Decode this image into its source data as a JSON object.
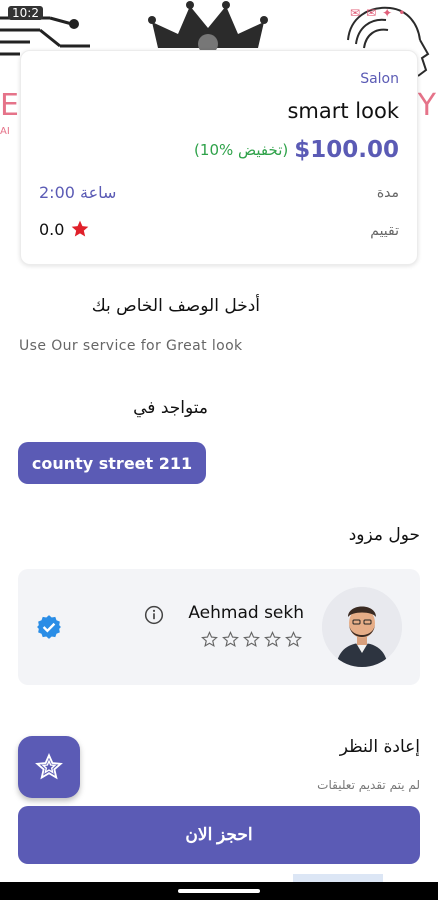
{
  "status_bar": {
    "time": "10:2"
  },
  "hero": {
    "brand_left": "EA",
    "brand_right": "Y",
    "brand_sub": "AI"
  },
  "service": {
    "category": "Salon",
    "title": "smart look",
    "price": "$100.00",
    "discount": "(10% تخفيض)",
    "duration_label": "مدة",
    "duration_value": "2:00 ساعة",
    "rating_label": "تقييم",
    "rating_value": "0.0"
  },
  "description": {
    "heading": "أدخل الوصف الخاص بك",
    "text": "Use Our service for Great look"
  },
  "location": {
    "heading": "متواجد في",
    "address": "county street 211"
  },
  "provider": {
    "heading": "حول مزود",
    "name": "Aehmad sekh",
    "stars": 0
  },
  "reviews": {
    "heading": "إعادة النظر",
    "empty_text": "لم يتم تقديم تعليقات"
  },
  "book_button": {
    "label": "احجز الان"
  },
  "colors": {
    "primary": "#5b5bb5",
    "discount": "#2fa24a",
    "star": "#e0202a",
    "verified": "#2a8de6"
  }
}
